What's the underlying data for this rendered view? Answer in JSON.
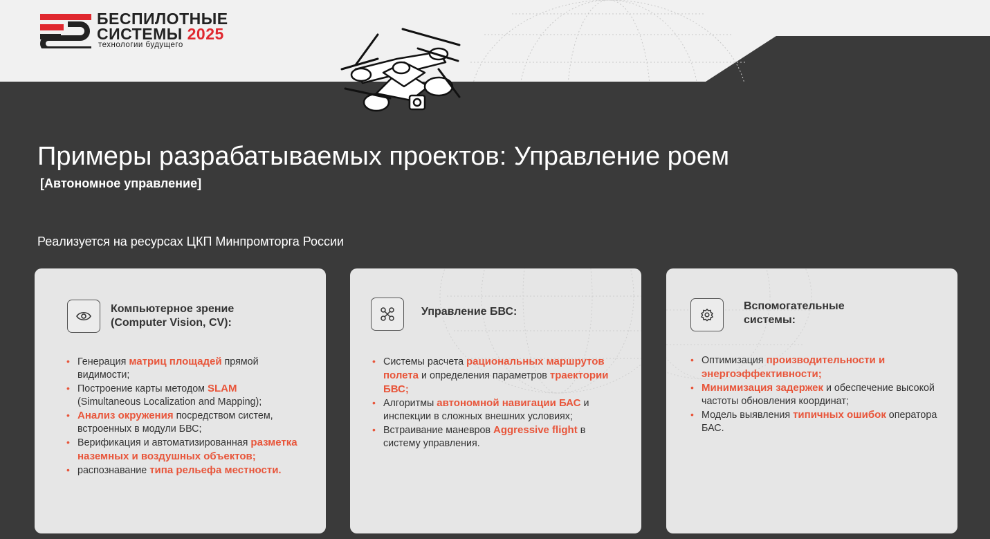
{
  "logo": {
    "title_line1": "БЕСПИЛОТНЫЕ",
    "title_line2": "СИСТЕМЫ",
    "year": "2025",
    "tagline": "технологии будущего"
  },
  "title": "Примеры разрабатываемых проектов: Управление роем",
  "subtitle": "[Автономное управление]",
  "intro": "Реализуется на ресурсах ЦКП Минпромторга России",
  "cards": [
    {
      "icon": "eye-icon",
      "title": "Компьютерное зрение (Computer Vision, CV):",
      "items": [
        [
          {
            "t": "Генерация "
          },
          {
            "t": "матриц площадей",
            "h": true
          },
          {
            "t": " прямой видимости;"
          }
        ],
        [
          {
            "t": "Построение карты методом "
          },
          {
            "t": "SLAM",
            "h": true
          },
          {
            "t": " (Simultaneous Localization and Mapping);"
          }
        ],
        [
          {
            "t": "Анализ окружения",
            "h": true
          },
          {
            "t": " посредством систем, встроенных в модули БВС;"
          }
        ],
        [
          {
            "t": "Верификация и автоматизированная "
          },
          {
            "t": "разметка наземных и воздушных объектов;",
            "h": true
          }
        ],
        [
          {
            "t": "распознавание "
          },
          {
            "t": "типа рельефа местности.",
            "h": true
          }
        ]
      ]
    },
    {
      "icon": "drone-icon",
      "title": "Управление БВС:",
      "items": [
        [
          {
            "t": "Системы расчета "
          },
          {
            "t": "рациональных маршрутов полета",
            "h": true
          },
          {
            "t": " и определения параметров "
          },
          {
            "t": "траектории БВС;",
            "h": true
          }
        ],
        [
          {
            "t": "Алгоритмы "
          },
          {
            "t": "автономной навигации БАС",
            "h": true
          },
          {
            "t": " и инспекции в сложных внешних условиях;"
          }
        ],
        [
          {
            "t": "Встраивание маневров "
          },
          {
            "t": "Aggressive flight",
            "h": true
          },
          {
            "t": " в систему управления."
          }
        ]
      ]
    },
    {
      "icon": "gear-icon",
      "title": "Вспомогательные системы:",
      "items": [
        [
          {
            "t": "Оптимизация "
          },
          {
            "t": "производительности и энергоэффективности;",
            "h": true
          }
        ],
        [
          {
            "t": "Минимизация задержек",
            "h": true
          },
          {
            "t": " и обеспечение высокой частоты обновления координат;"
          }
        ],
        [
          {
            "t": "Модель выявления "
          },
          {
            "t": "типичных ошибок",
            "h": true
          },
          {
            "t": " оператора БАС."
          }
        ]
      ]
    }
  ]
}
